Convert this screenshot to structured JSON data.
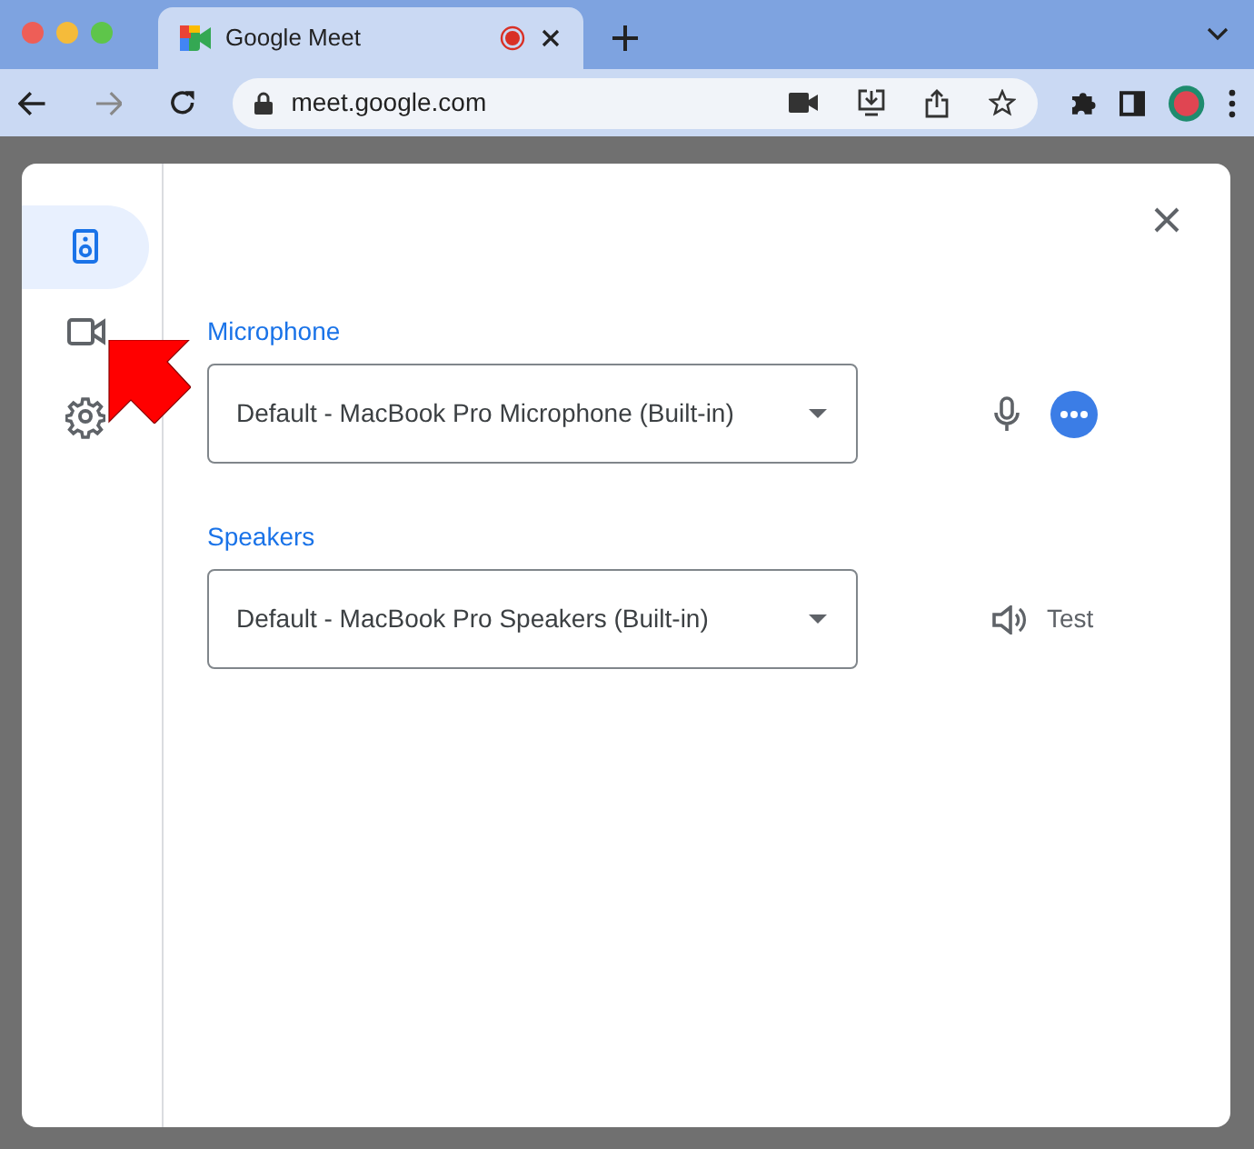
{
  "browser": {
    "tab_title": "Google Meet",
    "recording": true,
    "url": "meet.google.com"
  },
  "sidebar": {
    "items": [
      {
        "kind": "audio",
        "selected": true
      },
      {
        "kind": "video",
        "selected": false
      },
      {
        "kind": "general",
        "selected": false
      }
    ]
  },
  "sections": [
    {
      "kind": "microphone",
      "label": "Microphone",
      "device": "Default - MacBook Pro Microphone (Built-in)"
    },
    {
      "kind": "speakers",
      "label": "Speakers",
      "device": "Default - MacBook Pro Speakers (Built-in)",
      "action": "Test"
    }
  ]
}
